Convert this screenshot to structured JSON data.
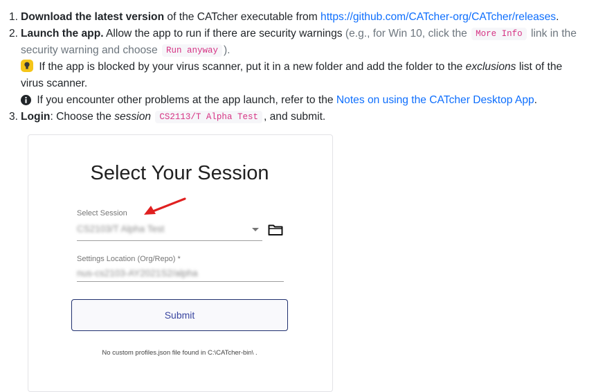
{
  "steps": [
    {
      "num": "1.",
      "bold": "Download the latest version",
      "text": " of the CATcher executable from ",
      "link": "https://github.com/CATcher-org/CATcher/releases",
      "end": "."
    },
    {
      "num": "2.",
      "bold": "Launch the app.",
      "text": " Allow the app to run if there are security warnings",
      "muted_a": " (e.g., for Win 10, click the ",
      "code_a": "More Info",
      "muted_b": " link in the",
      "muted_c": "security warning and choose ",
      "code_b": "Run anyway",
      "muted_d": ").",
      "tip_a": " If the app is blocked by your virus scanner, put it in a new folder and add the folder to the ",
      "tip_em": "exclusions",
      "tip_b": " list of the",
      "tip_c": "virus scanner.",
      "info_a": " If you encounter other problems at the app launch, refer to the ",
      "info_link": "Notes on using the CATcher Desktop App",
      "info_end": "."
    },
    {
      "num": "3.",
      "bold": "Login",
      "text_a": ": Choose the ",
      "em": "session",
      "code": "CS2113/T Alpha Test",
      "text_b": ", and submit."
    }
  ],
  "icons": {
    "tip": "lightbulb-icon",
    "info": "info-circle-icon",
    "folder": "folder-icon"
  },
  "session_panel": {
    "title": "Select Your Session",
    "select_label": "Select Session",
    "select_value": "CS2103/T Alpha Test",
    "settings_label": "Settings Location (Org/Repo) *",
    "settings_value": "nus-cs2103-AY2021S2/alpha",
    "submit_label": "Submit",
    "footnote": "No custom profiles.json file found in C:\\CATcher-bin\\ ."
  },
  "colors": {
    "link": "#0d6efd",
    "code": "#d63384",
    "arrow": "#e02020",
    "tip_badge": "#f5c518"
  }
}
